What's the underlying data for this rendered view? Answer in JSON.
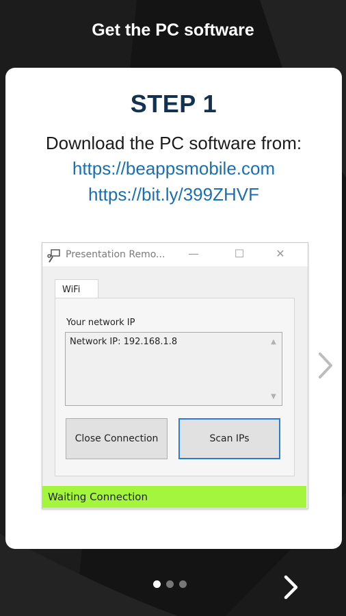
{
  "header": {
    "title": "Get the PC software"
  },
  "card": {
    "step_title": "STEP 1",
    "instruction": "Download the PC software from:",
    "links": [
      "https://beappsmobile.com",
      "https://bit.ly/399ZHVF"
    ]
  },
  "window": {
    "title": "Presentation Remo...",
    "tab_label": "WiFi",
    "network_label": "Your network IP",
    "network_ip_text": "Network IP: 192.168.1.8",
    "close_button": "Close Connection",
    "scan_button": "Scan IPs",
    "status": "Waiting Connection",
    "status_color": "#a3f53e"
  },
  "pager": {
    "pages": 3,
    "current": 1
  },
  "icons": {
    "side_next": "chevron-right-icon",
    "next": "chevron-right-icon"
  }
}
